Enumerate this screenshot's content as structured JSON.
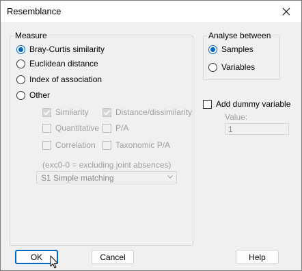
{
  "window": {
    "title": "Resemblance"
  },
  "measure": {
    "legend": "Measure",
    "options": [
      {
        "label": "Bray-Curtis similarity",
        "selected": true
      },
      {
        "label": "Euclidean distance",
        "selected": false
      },
      {
        "label": "Index of association",
        "selected": false
      },
      {
        "label": "Other",
        "selected": false
      }
    ],
    "other_checks": {
      "similarity": {
        "label": "Similarity",
        "checked": true
      },
      "distance": {
        "label": "Distance/dissimilarity",
        "checked": true
      },
      "quantitative": {
        "label": "Quantitative",
        "checked": false
      },
      "pa": {
        "label": "P/A",
        "checked": false
      },
      "correlation": {
        "label": "Correlation",
        "checked": false
      },
      "taxonomic_pa": {
        "label": "Taxonomic P/A",
        "checked": false
      }
    },
    "note": "(exc0-0 = excluding joint absences)",
    "select_value": "S1 Simple matching"
  },
  "analyse": {
    "legend": "Analyse between",
    "options": [
      {
        "label": "Samples",
        "selected": true
      },
      {
        "label": "Variables",
        "selected": false
      }
    ]
  },
  "dummy": {
    "label": "Add dummy variable",
    "checked": false,
    "value_label": "Value:",
    "value": "1"
  },
  "buttons": {
    "ok": "OK",
    "cancel": "Cancel",
    "help": "Help"
  },
  "colors": {
    "accent": "#0067c0",
    "disabled_text": "#a0a0a0",
    "background": "#f0f0f0"
  }
}
